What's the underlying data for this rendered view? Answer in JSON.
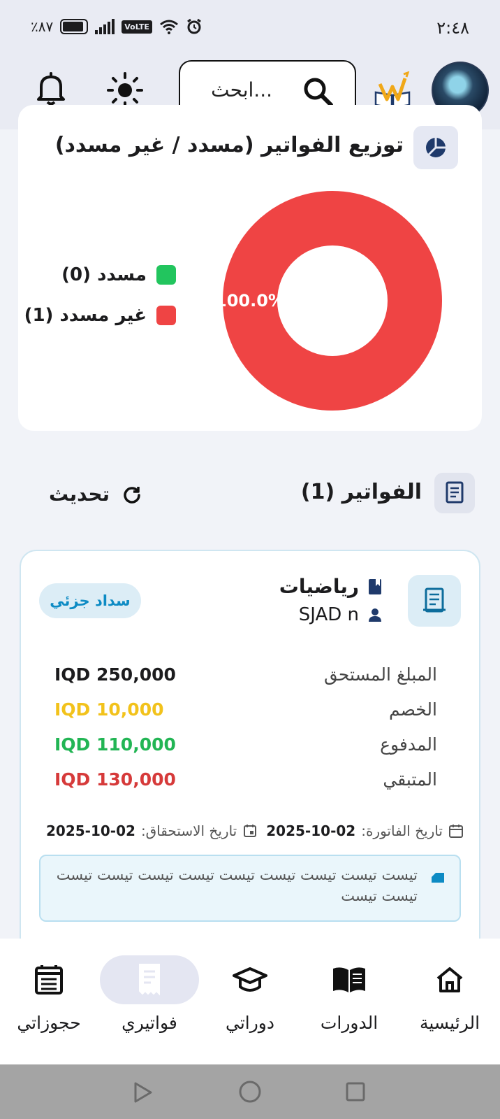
{
  "status_bar": {
    "time": "٢:٤٨",
    "battery": "٪٨٧",
    "network_badge": "VoLTE"
  },
  "header": {
    "search_placeholder": "ابحث..."
  },
  "chart": {
    "title": "توزيع الفواتير (مسدد / غير مسدد)",
    "slice_label": "100.0%",
    "legend": [
      {
        "label": "مسدد (0)",
        "color": "#22c55e"
      },
      {
        "label": "غير مسدد (1)",
        "color": "#ef4444"
      }
    ]
  },
  "chart_data": {
    "type": "pie",
    "title": "توزيع الفواتير (مسدد / غير مسدد)",
    "categories": [
      "مسدد",
      "غير مسدد"
    ],
    "values": [
      0,
      1
    ],
    "colors": [
      "#22c55e",
      "#ef4444"
    ],
    "legend": "left"
  },
  "invoices": {
    "title": "الفواتير (1)",
    "refresh_label": "تحديث",
    "card": {
      "course": "رياضيات",
      "student": "SJAD n",
      "status_badge": "سداد جزئي",
      "rows": [
        {
          "label": "المبلغ المستحق",
          "value": "IQD 250,000",
          "color": "#1c1c1e"
        },
        {
          "label": "الخصم",
          "value": "IQD 10,000",
          "color": "#f2c21b"
        },
        {
          "label": "المدفوع",
          "value": "IQD 110,000",
          "color": "#22b554"
        },
        {
          "label": "المتبقي",
          "value": "IQD 130,000",
          "color": "#d63a3a"
        }
      ],
      "invoice_date_label": "تاريخ الفاتورة:",
      "invoice_date": "2025-10-02",
      "due_date_label": "تاريخ الاستحقاق:",
      "due_date": "2025-10-02",
      "note": "تيست تيست تيست تيست تيست تيست تيست تيست تيست تيست تيست"
    }
  },
  "bottom_nav": {
    "items": [
      {
        "label": "الرئيسية",
        "icon": "home-icon"
      },
      {
        "label": "الدورات",
        "icon": "book-icon"
      },
      {
        "label": "دوراتي",
        "icon": "graduation-cap-icon"
      },
      {
        "label": "فواتيري",
        "icon": "receipt-icon",
        "active": true
      },
      {
        "label": "حجوزاتي",
        "icon": "calendar-list-icon"
      }
    ]
  }
}
